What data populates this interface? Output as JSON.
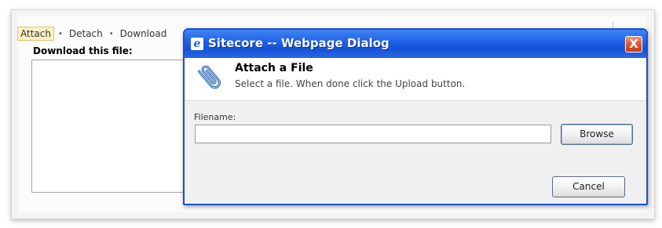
{
  "toolbar": {
    "items": [
      {
        "label": "Attach"
      },
      {
        "label": "Detach"
      },
      {
        "label": "Download"
      }
    ],
    "separator": "•"
  },
  "field": {
    "label": "Download this file:"
  },
  "dialog": {
    "title": "Sitecore -- Webpage Dialog",
    "title_icon": "ie-page-icon",
    "close_label": "X",
    "header_title": "Attach a File",
    "header_subtitle": "Select a file. When done click the Upload button.",
    "header_icon": "paperclip-icon",
    "filename_label": "Filename:",
    "filename_value": "",
    "browse_label": "Browse",
    "cancel_label": "Cancel"
  },
  "colors": {
    "titlebar": "#1f5fe8",
    "dialog_border": "#1a4fd0",
    "close_button": "#e4502a",
    "toolbar_active": "#fbf1c4"
  }
}
